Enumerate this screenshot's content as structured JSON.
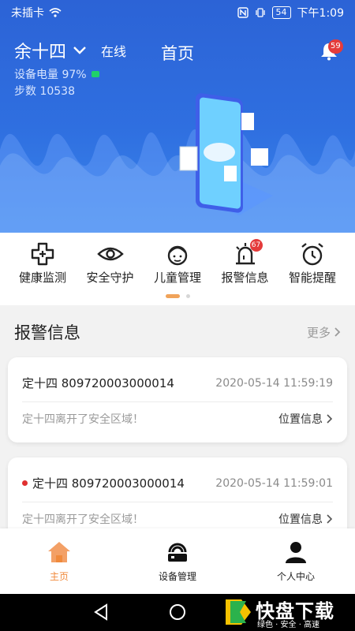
{
  "status_bar": {
    "carrier": "未插卡",
    "battery": "54",
    "time": "下午1:09"
  },
  "header": {
    "user_name": "余十四",
    "online": "在线",
    "title": "首页",
    "notification_count": "59",
    "device_battery": "设备电量 97%",
    "steps": "步数 10538"
  },
  "features": [
    {
      "label": "健康监测",
      "icon": "health-cross-icon"
    },
    {
      "label": "安全守护",
      "icon": "eye-icon"
    },
    {
      "label": "儿童管理",
      "icon": "child-face-icon"
    },
    {
      "label": "报警信息",
      "icon": "alarm-light-icon",
      "badge": "67"
    },
    {
      "label": "智能提醒",
      "icon": "alarm-clock-icon"
    }
  ],
  "alerts": {
    "title": "报警信息",
    "more": "更多",
    "items": [
      {
        "device": "定十四 809720003000014",
        "time": "2020-05-14 11:59:19",
        "message": "定十四离开了安全区域！",
        "location_label": "位置信息",
        "unread": false
      },
      {
        "device": "定十四 809720003000014",
        "time": "2020-05-14 11:59:01",
        "message": "定十四离开了安全区域！",
        "location_label": "位置信息",
        "unread": true
      }
    ]
  },
  "bottom_nav": [
    {
      "label": "主页",
      "icon": "home-icon",
      "active": true
    },
    {
      "label": "设备管理",
      "icon": "device-icon",
      "active": false
    },
    {
      "label": "个人中心",
      "icon": "person-icon",
      "active": false
    }
  ],
  "watermark": {
    "main": "快盘下载",
    "sub": "绿色 · 安全 · 高速",
    "logo_letter": "K"
  },
  "colors": {
    "header_blue": "#2f6fe0",
    "accent_orange": "#f08a3c",
    "badge_red": "#e43b3b"
  }
}
